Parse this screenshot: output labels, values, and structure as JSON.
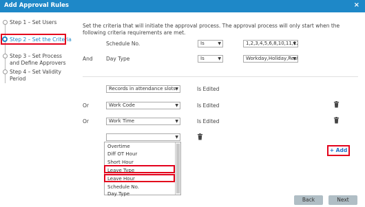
{
  "window": {
    "title": "Add Approval Rules",
    "close": "×"
  },
  "steps": [
    {
      "label": "Step 1 – Set Users"
    },
    {
      "label": "Step 2 – Set the Criteria"
    },
    {
      "label1": "Step 3 – Set Process",
      "label2": "and Define Approvers"
    },
    {
      "label1": "Step 4 – Set Validity",
      "label2": "Period"
    }
  ],
  "description": "Set the criteria that will initiate the approval process. The approval process will only start when the following criteria requirements are met.",
  "criteria": {
    "row1": {
      "field": "Schedule No.",
      "operator": "Is",
      "value": "1,2,3,4,5,6,8,10,11,12,13,1"
    },
    "row2": {
      "conjunction": "And",
      "field": "Day Type",
      "operator": "Is",
      "value": "Workday,Holiday,Rest"
    }
  },
  "conditions": [
    {
      "conjunction": "",
      "field": "Records in attendance slots",
      "status": "Is Edited"
    },
    {
      "conjunction": "Or",
      "field": "Work Code",
      "status": "Is Edited"
    },
    {
      "conjunction": "Or",
      "field": "Work Time",
      "status": "Is Edited"
    }
  ],
  "new_condition": {
    "field": ""
  },
  "dropdown_options": [
    "Overtime",
    "Diff OT Hour",
    "Short Hour",
    "Leave Type",
    "Leave Hour",
    "Schedule No.",
    "Day Type"
  ],
  "buttons": {
    "add": "+ Add",
    "back": "Back",
    "next": "Next"
  },
  "colors": {
    "accent": "#1e88c8",
    "highlight": "#e3001b"
  }
}
